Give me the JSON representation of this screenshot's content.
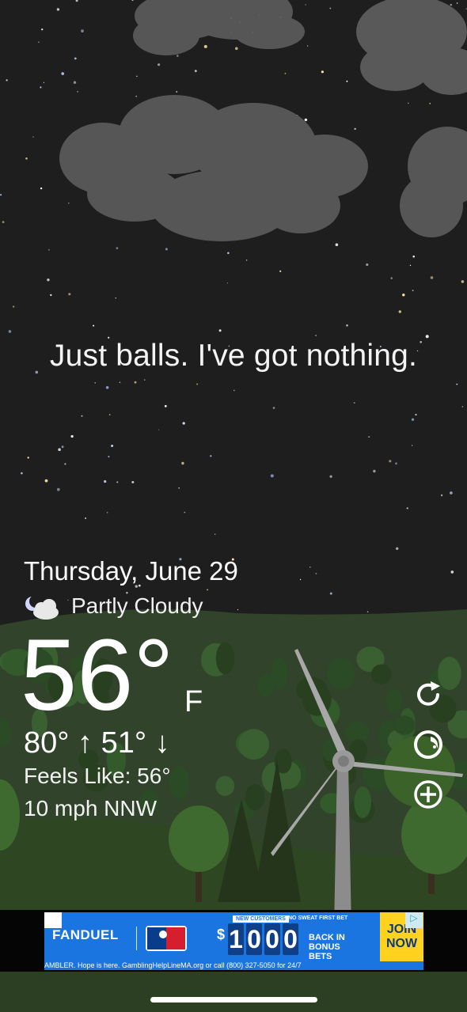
{
  "tagline": "Just balls. I've got nothing.",
  "weather": {
    "date": "Thursday, June 29",
    "condition": "Partly Cloudy",
    "condition_icon": "partly-cloudy-night-icon",
    "temperature": "56°",
    "unit": "F",
    "high_low": "80° ↑ 51° ↓",
    "feels_like": "Feels Like: 56°",
    "wind": "10 mph NNW"
  },
  "controls": [
    {
      "name": "refresh-icon"
    },
    {
      "name": "location-icon"
    },
    {
      "name": "add-icon"
    }
  ],
  "ad": {
    "tag_new_customers": "NEW CUSTOMERS",
    "tag_no_sweat": "NO SWEAT FIRST BET",
    "brand": "FANDUEL",
    "dollar": "$",
    "amount_digits": [
      "1",
      "0",
      "0",
      "0"
    ],
    "subline": "BACK IN BONUS BETS",
    "cta": "JOIN NOW",
    "disclaimer": "AMBLER. Hope is here. GamblingHelpLineMA.org or call (800) 327-5050 for 24/7"
  },
  "colors": {
    "sky": "#1e1e1e",
    "hills": "#34472b",
    "ground": "#2f4a24",
    "ad_blue": "#1b75e0",
    "cta_yellow": "#ffd21f"
  }
}
